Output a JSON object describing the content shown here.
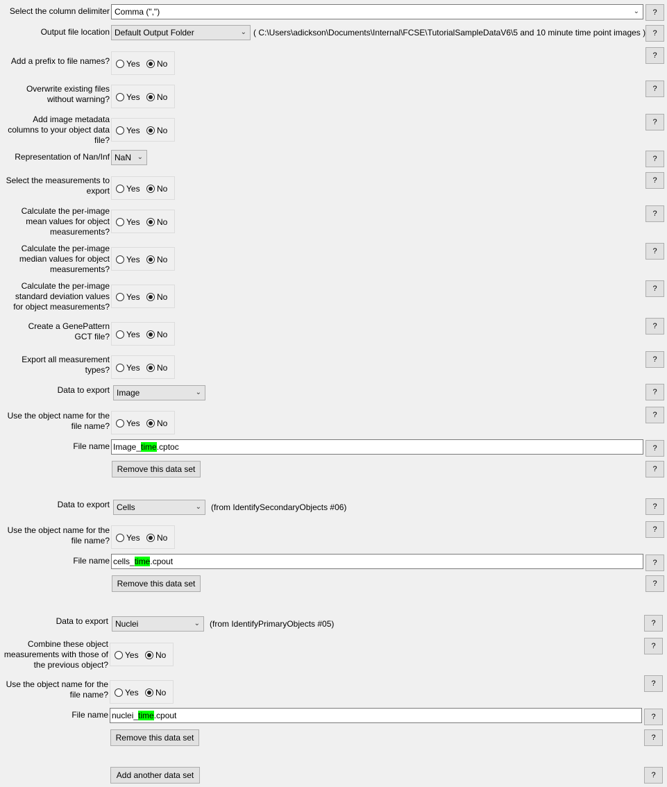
{
  "radio_yes": "Yes",
  "radio_no": "No",
  "help_label": "?",
  "delimiter": {
    "label": "Select the column delimiter",
    "value": "Comma (\",\")"
  },
  "output_location": {
    "label": "Output file location",
    "value": "Default Output Folder",
    "path": "( C:\\Users\\adickson\\Documents\\Internal\\FCSE\\TutorialSampleDataV6\\5 and 10 minute time point images )"
  },
  "prefix": {
    "label": "Add a prefix to file names?",
    "selected": "No"
  },
  "overwrite": {
    "label": "Overwrite existing files without warning?",
    "selected": "No"
  },
  "metadata": {
    "label": "Add image metadata columns to your object data file?",
    "selected": "No"
  },
  "nan_rep": {
    "label": "Representation of Nan/Inf",
    "value": "NaN"
  },
  "select_measurements": {
    "label": "Select the measurements to export",
    "selected": "No"
  },
  "per_image_mean": {
    "label": "Calculate the per-image mean values for object measurements?",
    "selected": "No"
  },
  "per_image_median": {
    "label": "Calculate the per-image median values for object measurements?",
    "selected": "No"
  },
  "per_image_std": {
    "label": "Calculate the per-image standard deviation values for object measurements?",
    "selected": "No"
  },
  "gct": {
    "label": "Create a GenePattern GCT file?",
    "selected": "No"
  },
  "export_all": {
    "label": "Export all measurement types?",
    "selected": "No"
  },
  "datasets": [
    {
      "export_label": "Data to export",
      "export_value": "Image",
      "source": "",
      "use_name_label": "Use the object name for the file name?",
      "use_name_selected": "No",
      "file_label": "File name",
      "file_pre": "Image_",
      "file_hl": "time",
      "file_post": ".cptoc",
      "remove_label": "Remove this data set"
    },
    {
      "export_label": "Data to export",
      "export_value": "Cells",
      "source": "(from IdentifySecondaryObjects #06)",
      "use_name_label": "Use the object name for the file name?",
      "use_name_selected": "No",
      "file_label": "File name",
      "file_pre": "cells_",
      "file_hl": "time",
      "file_post": ".cpout",
      "remove_label": "Remove this data set"
    },
    {
      "export_label": "Data to export",
      "export_value": "Nuclei",
      "source": "(from IdentifyPrimaryObjects #05)",
      "combine_label": "Combine these object measurements with those of the previous object?",
      "combine_selected": "No",
      "use_name_label": "Use the object name for the file name?",
      "use_name_selected": "No",
      "file_label": "File name",
      "file_pre": "nuclei_",
      "file_hl": "time",
      "file_post": ".cpout",
      "remove_label": "Remove this data set"
    }
  ],
  "add_dataset_label": "Add another data set"
}
